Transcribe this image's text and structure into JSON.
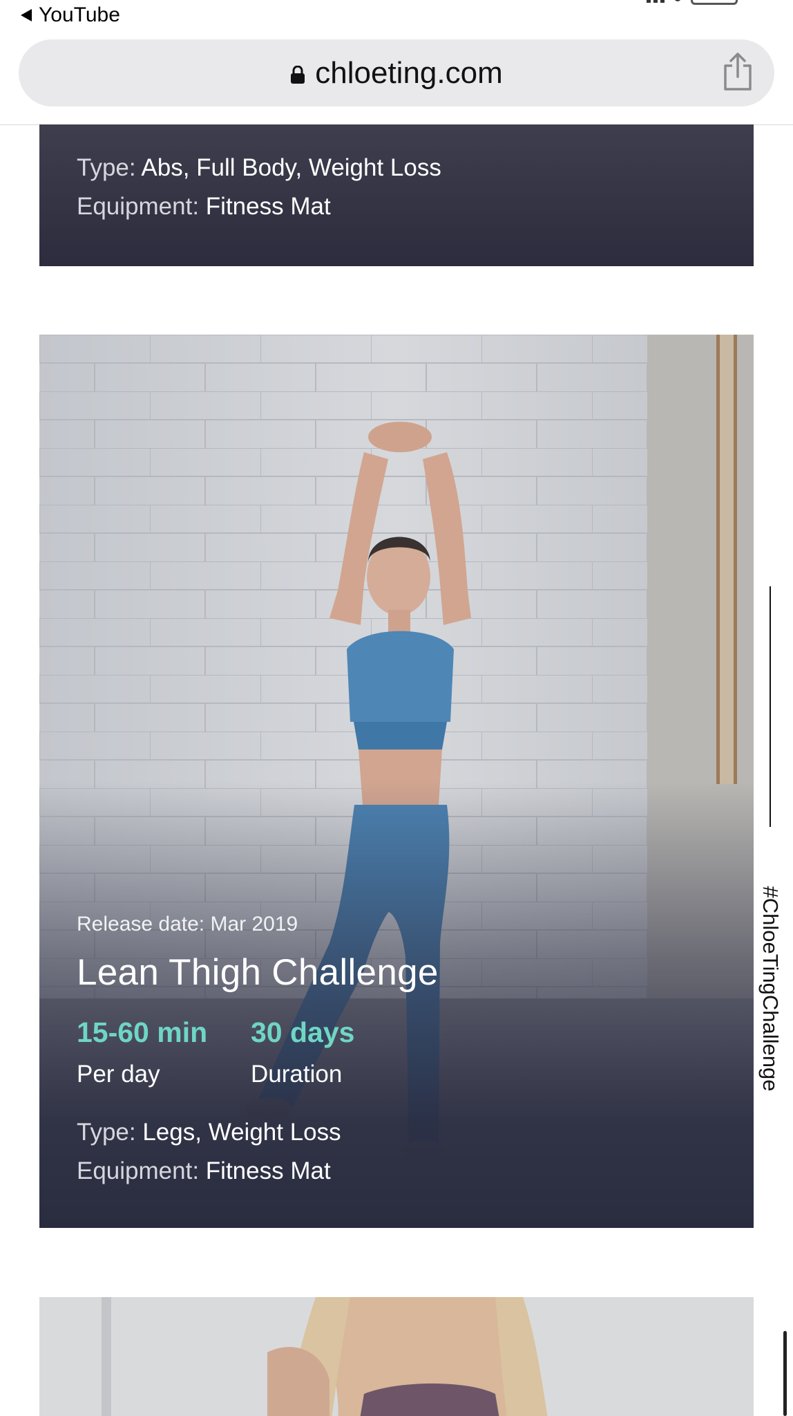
{
  "statusbar": {
    "back_app": "YouTube"
  },
  "browser": {
    "url": "chloeting.com",
    "lock": "lock-icon",
    "share": "share-icon"
  },
  "cards": [
    {
      "type_label": "Type:",
      "type_value": "Abs, Full Body, Weight Loss",
      "equipment_label": "Equipment:",
      "equipment_value": "Fitness Mat"
    },
    {
      "release": "Release date: Mar 2019",
      "title": "Lean Thigh Challenge",
      "stat1_value": "15-60 min",
      "stat1_label": "Per day",
      "stat2_value": "30 days",
      "stat2_label": "Duration",
      "type_label": "Type:",
      "type_value": "Legs, Weight Loss",
      "equipment_label": "Equipment:",
      "equipment_value": "Fitness Mat"
    }
  ],
  "side": {
    "hashtag": "#ChloeTingChallenge"
  },
  "colors": {
    "accent": "#6fd6c4",
    "card_dark": "#2a2c40",
    "url_bar": "#e9e9ec"
  }
}
